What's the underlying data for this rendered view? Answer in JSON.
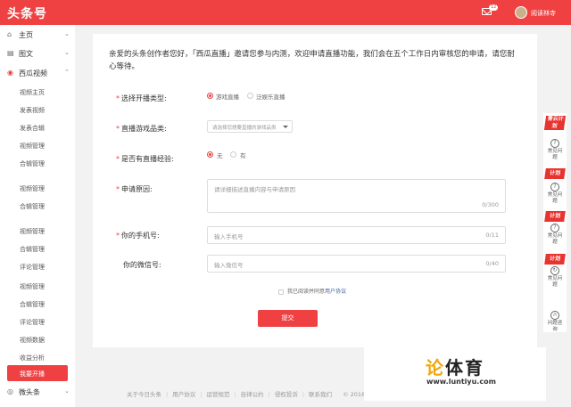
{
  "app": {
    "logo": "头条号",
    "mail_badge": "12",
    "user_name": "阅读林寺"
  },
  "sidebar": {
    "groups": [
      {
        "label": "主页",
        "icon": "home-icon"
      },
      {
        "label": "图文",
        "icon": "article-icon"
      },
      {
        "label": "西瓜视频",
        "icon": "xigua-video-icon"
      },
      {
        "label": "微头条",
        "icon": "weitoutiao-icon"
      }
    ],
    "items": [
      "视频主页",
      "发表视频",
      "发表合辑",
      "视频管理",
      "合辑管理",
      "视频管理",
      "合辑管理",
      "视频管理",
      "合辑管理",
      "评论管理",
      "视频管理",
      "合辑管理",
      "评论管理",
      "视频数据",
      "收益分析",
      "我要开播"
    ]
  },
  "form": {
    "intro": "亲爱的头条创作者您好，「西瓜直播」邀请您参与内测，欢迎申请直播功能，我们会在五个工作日内审核您的申请，请您耐心等待。",
    "type": {
      "label": "选择开播类型:",
      "options": [
        "游戏直播",
        "泛娱乐直播"
      ]
    },
    "category": {
      "label": "直播游戏品类:",
      "placeholder": "请选择您想要直播的游戏品类"
    },
    "experience": {
      "label": "是否有直播经验:",
      "options": [
        "无",
        "有"
      ]
    },
    "reason": {
      "label": "申请原因:",
      "placeholder": "请详细描述直播内容与申请原因",
      "count": "0/300"
    },
    "phone": {
      "label": "你的手机号:",
      "placeholder": "输入手机号",
      "count": "0/11"
    },
    "wechat": {
      "label": "你的微信号:",
      "placeholder": "输入微信号",
      "count": "0/40"
    },
    "agree_text": "我已阅读并同意",
    "agree_link": "用户协议",
    "submit": "提交"
  },
  "footer": {
    "links": [
      "关于今日头条",
      "用户协议",
      "运营规范",
      "自律公约",
      "侵权投诉",
      "联系我们"
    ],
    "copyright": "© 2018"
  },
  "floatbar": {
    "tags": [
      "青云计划",
      "计划",
      "计划",
      "计划"
    ],
    "items": [
      {
        "icon": "help-icon",
        "label": "常见问题"
      },
      {
        "icon": "help-icon",
        "label": "常见问题"
      },
      {
        "icon": "help-icon",
        "label": "常见问题"
      },
      {
        "icon": "feedback-icon",
        "label": "常见问题"
      },
      {
        "icon": "headset-icon",
        "label": "问题咨询"
      }
    ]
  },
  "watermark": {
    "big_1": "论",
    "big_2": "体育",
    "url": "www.luntiyu.com"
  },
  "colors": {
    "brand": "#f04142",
    "link": "#406599"
  }
}
